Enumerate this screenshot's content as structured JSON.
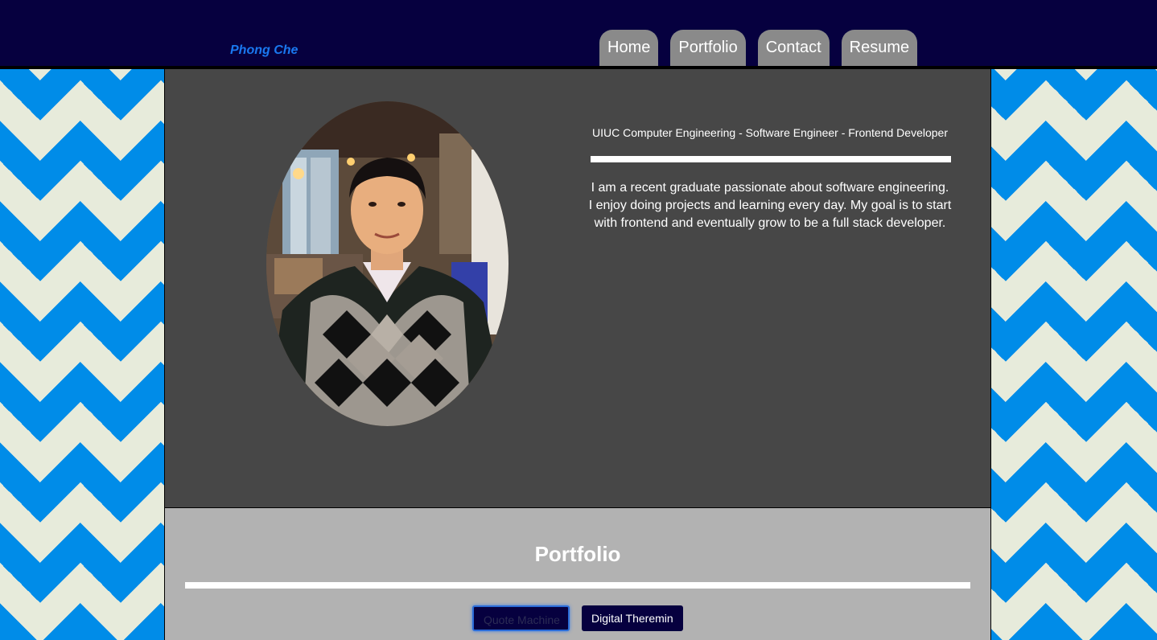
{
  "header": {
    "brand": "Phong Che",
    "nav": [
      {
        "label": "Home"
      },
      {
        "label": "Portfolio"
      },
      {
        "label": "Contact"
      },
      {
        "label": "Resume"
      }
    ]
  },
  "hero": {
    "tagline": "UIUC Computer Engineering - Software Engineer - Frontend Developer",
    "bio": "I am a recent graduate passionate about software engineering. I enjoy doing projects and learning every day. My goal is to start with frontend and eventually grow to be a full stack developer."
  },
  "portfolio": {
    "title": "Portfolio",
    "projects": [
      {
        "label": "Quote Machine"
      },
      {
        "label": "Digital Theremin"
      }
    ]
  },
  "colors": {
    "navbar": "#06003f",
    "brand": "#1a78f0",
    "nav_tab": "#8a8a8a",
    "hero_bg": "#474747",
    "portfolio_bg": "#b2b2b2",
    "chevron_blue": "#008ce8",
    "chevron_cream": "#e7ebdb"
  }
}
